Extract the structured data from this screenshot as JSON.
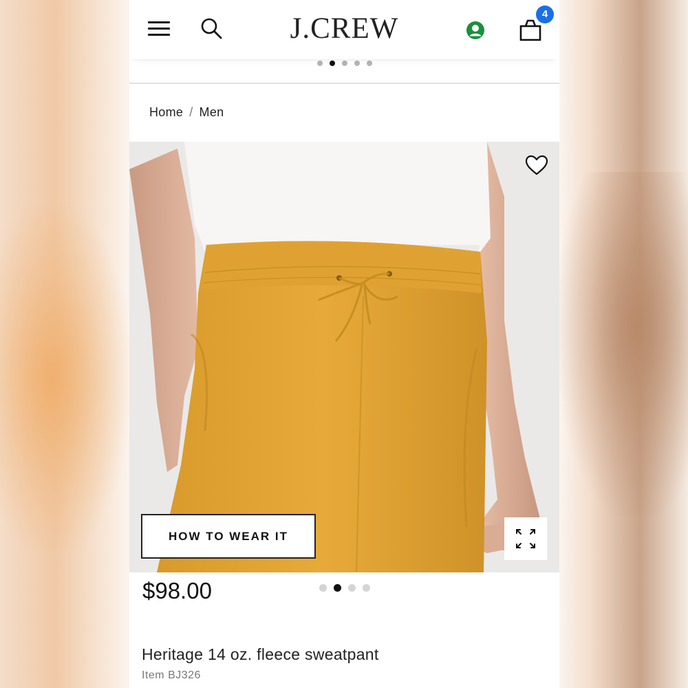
{
  "header": {
    "logo": "J.CREW",
    "bag_count": "4",
    "account_color": "#1a8f3c",
    "badge_color": "#1a6fe8"
  },
  "promo_carousel": {
    "total_dots": 5,
    "active_index": 1
  },
  "breadcrumb": {
    "items": [
      "Home",
      "Men"
    ],
    "separator": "/"
  },
  "product_image": {
    "pants_color": "#e2a534",
    "background_color": "#e9e8e6",
    "how_to_wear_label": "HOW TO WEAR IT",
    "gallery_total": 4,
    "gallery_active_index": 1
  },
  "product": {
    "price": "$98.00",
    "name": "Heritage 14 oz. fleece sweatpant",
    "item_code": "Item BJ326"
  },
  "icons": [
    "menu-icon",
    "search-icon",
    "account-icon",
    "shopping-bag-icon",
    "heart-icon",
    "expand-icon"
  ]
}
